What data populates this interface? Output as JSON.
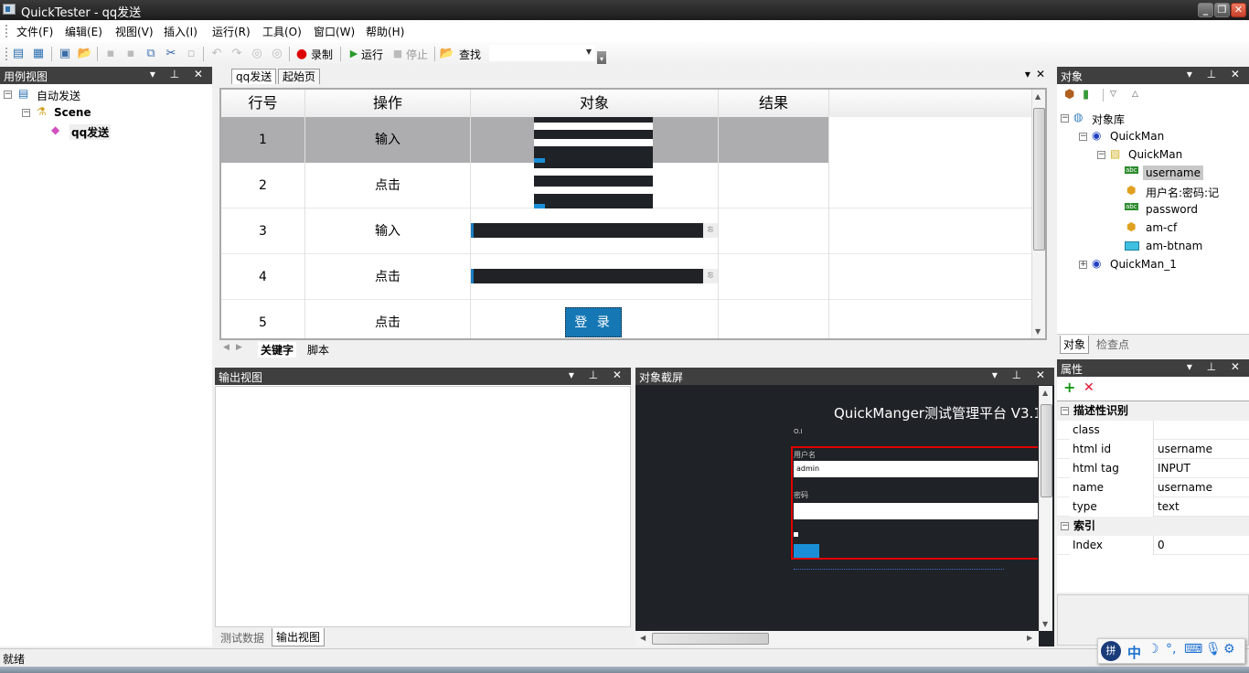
{
  "window": {
    "title": "QuickTester - qq发送"
  },
  "menu": [
    "文件(F)",
    "编辑(E)",
    "视图(V)",
    "插入(I)",
    "运行(R)",
    "工具(O)",
    "窗口(W)",
    "帮助(H)"
  ],
  "toolbar": {
    "record_label": "录制",
    "run_label": "运行",
    "stop_label": "停止",
    "find_label": "查找",
    "find_value": ""
  },
  "case_view": {
    "title": "用例视图",
    "tree": [
      {
        "label": "自动发送",
        "level": 0
      },
      {
        "label": "Scene",
        "level": 1
      },
      {
        "label": "qq发送",
        "level": 2
      }
    ]
  },
  "editor": {
    "tabs": [
      "qq发送",
      "起始页"
    ],
    "columns": [
      "行号",
      "操作",
      "对象",
      "结果"
    ],
    "rows": [
      {
        "line": "1",
        "action": "输入",
        "object": "screenshot-form",
        "result": ""
      },
      {
        "line": "2",
        "action": "点击",
        "object": "screenshot-form",
        "result": ""
      },
      {
        "line": "3",
        "action": "输入",
        "object": "screenshot-input",
        "result": ""
      },
      {
        "line": "4",
        "action": "点击",
        "object": "screenshot-input",
        "result": ""
      },
      {
        "line": "5",
        "action": "点击",
        "object": "登 录",
        "result": ""
      }
    ],
    "bottom_tabs": [
      "关键字",
      "脚本"
    ]
  },
  "output_view": {
    "title": "输出视图",
    "tabs": [
      "测试数据",
      "输出视图"
    ]
  },
  "snapshot": {
    "title": "对象截屏",
    "heading": "QuickManger测试管理平台 V3.1",
    "username_value": "admin"
  },
  "objects": {
    "title": "对象",
    "tree": [
      {
        "label": "对象库",
        "level": 0,
        "icon": "globe-icon"
      },
      {
        "label": "QuickMan",
        "level": 1,
        "icon": "browser-icon"
      },
      {
        "label": "QuickMan",
        "level": 2,
        "icon": "page-icon"
      },
      {
        "label": "username",
        "level": 3,
        "icon": "textbox-icon",
        "selected": true
      },
      {
        "label": "用户名:密码:记",
        "level": 3,
        "icon": "webelement-icon"
      },
      {
        "label": "password",
        "level": 3,
        "icon": "textbox-icon"
      },
      {
        "label": "am-cf",
        "level": 3,
        "icon": "webelement-icon"
      },
      {
        "label": "am-btnam",
        "level": 3,
        "icon": "button-icon"
      },
      {
        "label": "QuickMan_1",
        "level": 1,
        "icon": "browser-icon"
      }
    ],
    "tabs": [
      "对象",
      "检查点"
    ]
  },
  "properties": {
    "title": "属性",
    "groups": [
      {
        "name": "描述性识别",
        "items": [
          {
            "key": "class",
            "value": ""
          },
          {
            "key": "html id",
            "value": "username"
          },
          {
            "key": "html tag",
            "value": "INPUT"
          },
          {
            "key": "name",
            "value": "username"
          },
          {
            "key": "type",
            "value": "text"
          }
        ]
      },
      {
        "name": "索引",
        "items": [
          {
            "key": "Index",
            "value": "0"
          }
        ]
      }
    ]
  },
  "status": {
    "text": "就绪"
  },
  "ime": {
    "mode": "中"
  }
}
